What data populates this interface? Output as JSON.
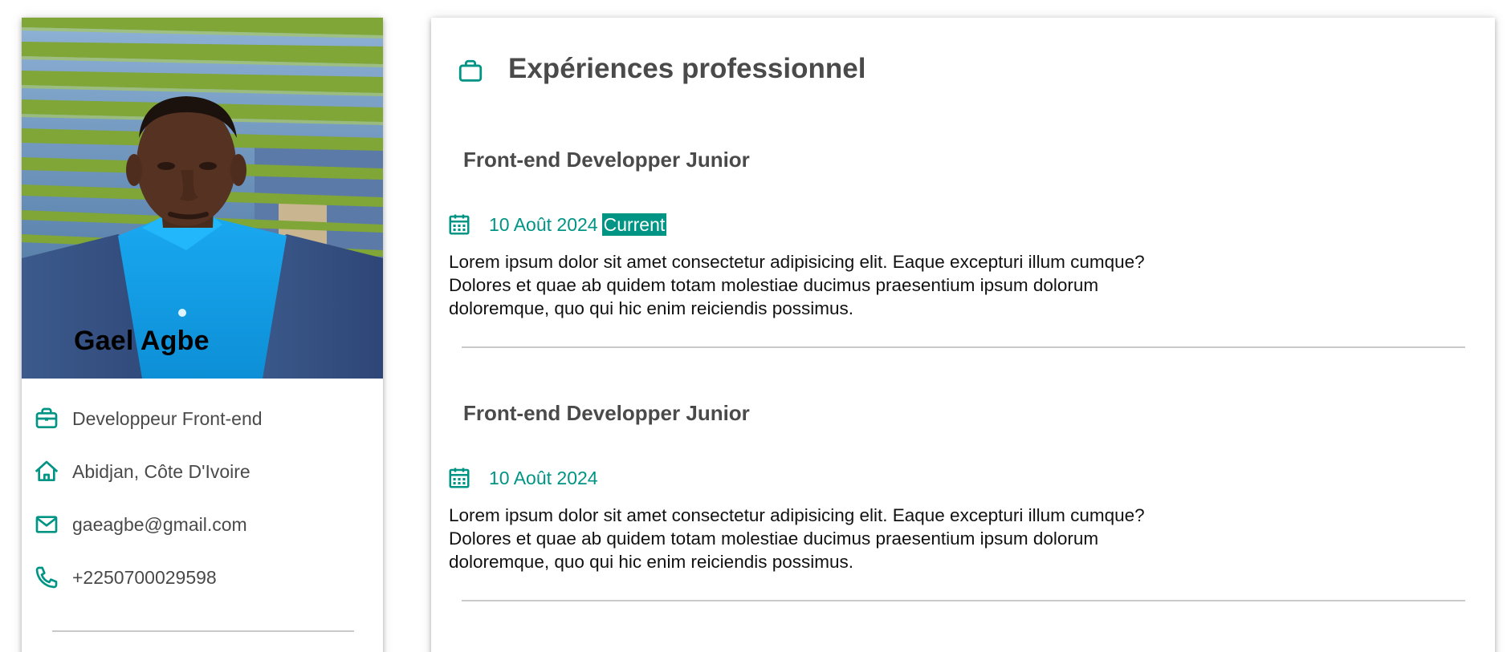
{
  "profile": {
    "name": "Gael Agbe",
    "photo_alt": "",
    "info": [
      {
        "icon": "briefcase-icon",
        "text": "Developpeur Front-end"
      },
      {
        "icon": "home-icon",
        "text": "Abidjan, Côte D'Ivoire"
      },
      {
        "icon": "mail-icon",
        "text": "gaeagbe@gmail.com"
      },
      {
        "icon": "phone-icon",
        "text": "+2250700029598"
      }
    ]
  },
  "experience": {
    "title": "Expériences professionnel",
    "header_icon": "briefcase-icon",
    "items": [
      {
        "role": "Front-end Developper Junior",
        "date": "10 Août 2024",
        "badge": "Current",
        "description": "Lorem ipsum dolor sit amet consectetur adipisicing elit. Eaque excepturi illum cumque? Dolores et quae ab quidem totam molestiae ducimus praesentium ipsum dolorum doloremque, quo qui hic enim reiciendis possimus."
      },
      {
        "role": "Front-end Developper Junior",
        "date": "10 Août 2024",
        "badge": "",
        "description": "Lorem ipsum dolor sit amet consectetur adipisicing elit. Eaque excepturi illum cumque? Dolores et quae ab quidem totam molestiae ducimus praesentium ipsum dolorum doloremque, quo qui hic enim reiciendis possimus."
      }
    ]
  },
  "colors": {
    "accent": "#009485",
    "text_dark": "#4a4a4a",
    "divider": "#c9c9c9"
  }
}
